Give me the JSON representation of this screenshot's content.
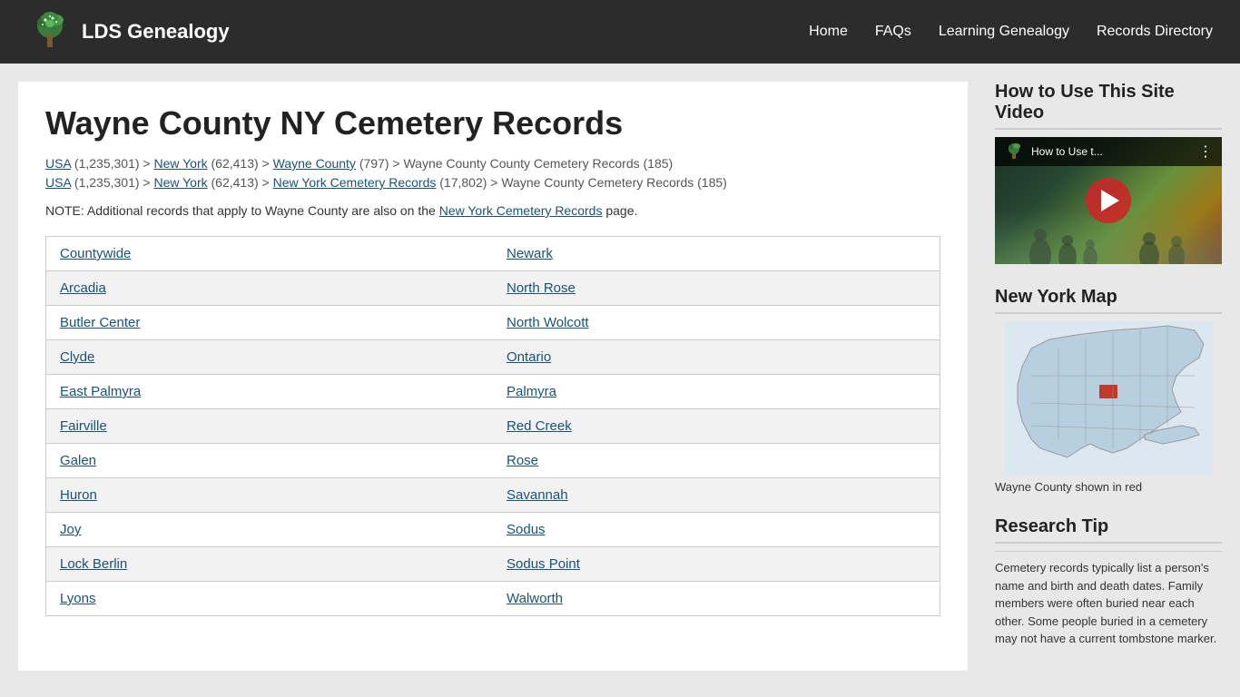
{
  "header": {
    "logo_text": "LDS Genealogy",
    "nav": [
      {
        "label": "Home",
        "id": "home"
      },
      {
        "label": "FAQs",
        "id": "faqs"
      },
      {
        "label": "Learning Genealogy",
        "id": "learning"
      },
      {
        "label": "Records Directory",
        "id": "records"
      }
    ]
  },
  "page": {
    "title": "Wayne County NY Cemetery Records",
    "breadcrumbs": [
      {
        "text": "USA (1,235,301) > New York (62,413) > Wayne County (797) > Wayne County County Cemetery Records (185)",
        "links": [
          {
            "label": "USA",
            "href": "#"
          },
          {
            "label": "New York",
            "href": "#"
          },
          {
            "label": "Wayne County",
            "href": "#"
          }
        ]
      },
      {
        "text": "USA (1,235,301) > New York (62,413) > New York Cemetery Records (17,802) > Wayne County Cemetery Records (185)",
        "links": [
          {
            "label": "USA",
            "href": "#"
          },
          {
            "label": "New York",
            "href": "#"
          },
          {
            "label": "New York Cemetery Records",
            "href": "#"
          }
        ]
      }
    ],
    "note": "NOTE: Additional records that apply to Wayne County are also on the New York Cemetery Records page.",
    "note_link": "New York Cemetery Records",
    "table_rows": [
      [
        "Countywide",
        "Newark"
      ],
      [
        "Arcadia",
        "North Rose"
      ],
      [
        "Butler Center",
        "North Wolcott"
      ],
      [
        "Clyde",
        "Ontario"
      ],
      [
        "East Palmyra",
        "Palmyra"
      ],
      [
        "Fairville",
        "Red Creek"
      ],
      [
        "Galen",
        "Rose"
      ],
      [
        "Huron",
        "Savannah"
      ],
      [
        "Joy",
        "Sodus"
      ],
      [
        "Lock Berlin",
        "Sodus Point"
      ],
      [
        "Lyons",
        "Walworth"
      ]
    ]
  },
  "sidebar": {
    "video_section_title": "How to Use This Site Video",
    "video_title_text": "How to Use t...",
    "map_section_title": "New York Map",
    "map_caption": "Wayne County shown in red",
    "tip_section_title": "Research Tip",
    "tip_text": "Cemetery records typically list a person's name and birth and death dates. Family members were often buried near each other. Some people buried in a cemetery may not have a current tombstone marker."
  }
}
